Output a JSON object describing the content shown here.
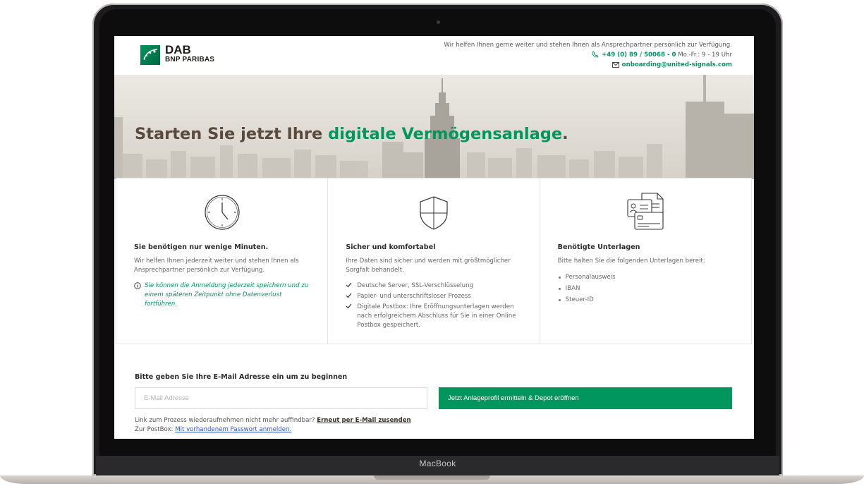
{
  "device": {
    "label": "MacBook"
  },
  "header": {
    "logo_main": "DAB",
    "logo_sub": "BNP PARIBAS",
    "contact_line": "Wir helfen Ihnen gerne weiter und stehen Ihnen als Ansprechpartner persönlich zur Verfügung.",
    "phone": "+49 (0) 89 / 50068 - 0",
    "hours": "Mo.-Fr.: 9 - 19 Uhr",
    "email": "onboarding@united-signals.com"
  },
  "hero": {
    "title_part1": "Starten Sie jetzt Ihre ",
    "title_accent": "digitale Vermögensanlage",
    "title_dot": "."
  },
  "cards": [
    {
      "icon": "clock-icon",
      "title": "Sie benötigen nur wenige Minuten.",
      "text": "Wir helfen Ihnen jederzeit weiter und stehen Ihnen als Ansprechpartner persönlich zur Verfügung.",
      "hint": "Sie können die Anmeldung jederzeit speichern und zu einem späteren Zeitpunkt ohne Datenverlust fortführen."
    },
    {
      "icon": "shield-icon",
      "title": "Sicher und komfortabel",
      "text": "Ihre Daten sind sicher und werden mit größtmöglicher Sorgfalt behandelt.",
      "items": [
        "Deutsche Server, SSL-Verschlüsselung",
        "Papier- und unterschriftsloser Prozess",
        "Digitale Postbox: Ihre Eröffnungsunterlagen werden nach erfolgreichem Abschluss für Sie in einer Online Postbox gespeichert."
      ]
    },
    {
      "icon": "documents-icon",
      "title": "Benötigte Unterlagen",
      "text": "Bitte halten Sie die folgenden Unterlagen bereit:",
      "items": [
        "Personalausweis",
        "IBAN",
        "Steuer-ID"
      ]
    }
  ],
  "form": {
    "title": "Bitte geben Sie Ihre E-Mail Adresse ein um zu beginnen",
    "email_placeholder": "E-Mail Adresse",
    "email_value": "",
    "cta_label": "Jetzt Anlageprofil ermitteln & Depot eröffnen",
    "resend_prefix": "Link zum Prozess wiederaufnehmen nicht mehr auffindbar?",
    "resend_link": "Erneut per E-Mail zusenden",
    "postbox_prefix": "Zur PostBox:",
    "postbox_link": "Mit vorhandenem Passwort anmelden."
  },
  "colors": {
    "brand_green": "#00965e",
    "hero_title_brown": "#5a4a3e",
    "link_blue": "#2d55c7"
  }
}
